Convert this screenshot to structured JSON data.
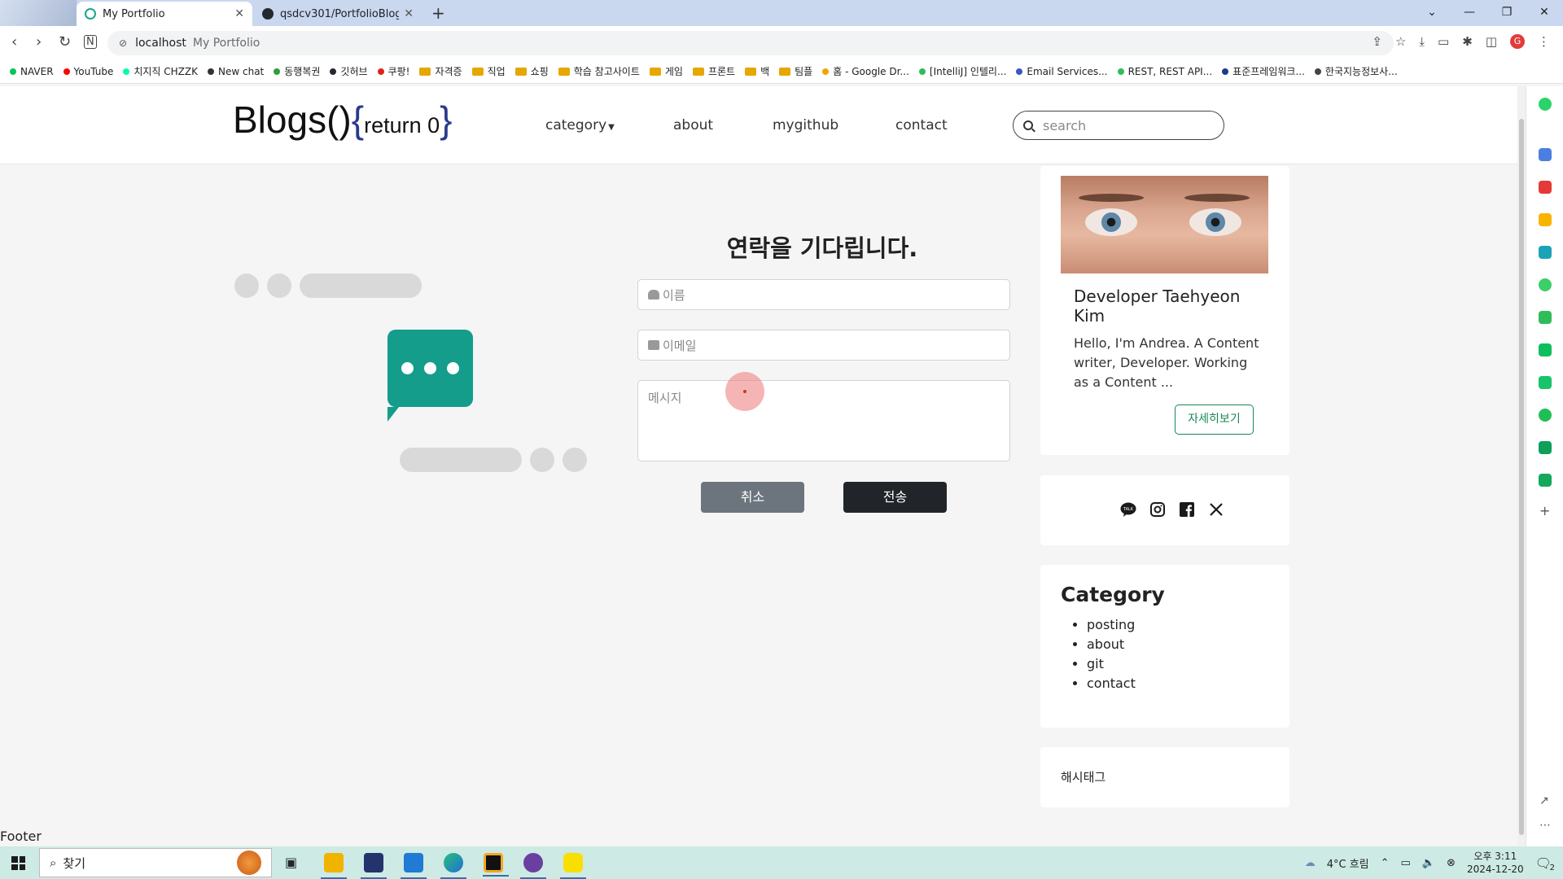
{
  "browser": {
    "tabs": [
      {
        "title": "My Portfolio"
      },
      {
        "title": "qsdcv301/PortfolioBlog: Front"
      }
    ],
    "new_tab_glyph": "+",
    "window_controls": [
      "⌄",
      "—",
      "❐",
      "✕"
    ],
    "address_host": "localhost",
    "address_page": "My Portfolio",
    "profile_initial": "G",
    "bookmarks": [
      {
        "label": "NAVER",
        "color": "#03c75a",
        "kind": "dot"
      },
      {
        "label": "YouTube",
        "color": "#ff0000",
        "kind": "dot"
      },
      {
        "label": "치지직 CHZZK",
        "color": "#00ffa3",
        "kind": "dot"
      },
      {
        "label": "New chat",
        "color": "#333333",
        "kind": "dot"
      },
      {
        "label": "동행복권",
        "color": "#2e9e3a",
        "kind": "dot"
      },
      {
        "label": "깃허브",
        "color": "#24292f",
        "kind": "dot"
      },
      {
        "label": "쿠팡!",
        "color": "#e2231a",
        "kind": "dot"
      },
      {
        "label": "자격증",
        "color": "#e6a700",
        "kind": "folder"
      },
      {
        "label": "직업",
        "color": "#e6a700",
        "kind": "folder"
      },
      {
        "label": "쇼핑",
        "color": "#e6a700",
        "kind": "folder"
      },
      {
        "label": "학습 참고사이트",
        "color": "#e6a700",
        "kind": "folder"
      },
      {
        "label": "게임",
        "color": "#e6a700",
        "kind": "folder"
      },
      {
        "label": "프론트",
        "color": "#e6a700",
        "kind": "folder"
      },
      {
        "label": "백",
        "color": "#e6a700",
        "kind": "folder"
      },
      {
        "label": "팀플",
        "color": "#e6a700",
        "kind": "folder"
      },
      {
        "label": "홈 - Google Dr...",
        "color": "#f4a400",
        "kind": "dot"
      },
      {
        "label": "[IntelliJ] 인텔리...",
        "color": "#2ebd59",
        "kind": "dot"
      },
      {
        "label": "Email Services...",
        "color": "#3a57c4",
        "kind": "dot"
      },
      {
        "label": "REST, REST API...",
        "color": "#2ebd59",
        "kind": "dot"
      },
      {
        "label": "표준프레임워크...",
        "color": "#1b3a8c",
        "kind": "dot"
      },
      {
        "label": "한국지능정보사...",
        "color": "#444444",
        "kind": "dot"
      }
    ]
  },
  "site": {
    "logo_main": "Blogs()",
    "logo_open": "{",
    "logo_return": "return 0",
    "logo_close": "}",
    "nav": {
      "category": "category",
      "about": "about",
      "mygithub": "mygithub",
      "contact": "contact"
    },
    "search_placeholder": "search",
    "form": {
      "title": "연락을 기다립니다.",
      "name_placeholder": "이름",
      "email_placeholder": "이메일",
      "message_placeholder": "메시지",
      "cancel_label": "취소",
      "send_label": "전송"
    },
    "profile": {
      "name": "Developer Taehyeon Kim",
      "description": "Hello, I'm Andrea. A Content writer, Developer. Working as a Content ...",
      "more_label": "자세히보기"
    },
    "social_icons": [
      "kakaotalk-icon",
      "instagram-icon",
      "facebook-icon",
      "x-icon"
    ],
    "category": {
      "title": "Category",
      "items": [
        "posting",
        "about",
        "git",
        "contact"
      ]
    },
    "hashtag_title": "해시태그",
    "footer": "Footer",
    "colors": {
      "accent_teal": "#139d8a",
      "cancel_gray": "#6c757d",
      "send_dark": "#212529",
      "more_green": "#198754"
    }
  },
  "taskbar": {
    "search_label": "찾기",
    "weather": "4°C 흐림",
    "time": "오후 3:11",
    "date": "2024-12-20",
    "notification_count": "2"
  }
}
